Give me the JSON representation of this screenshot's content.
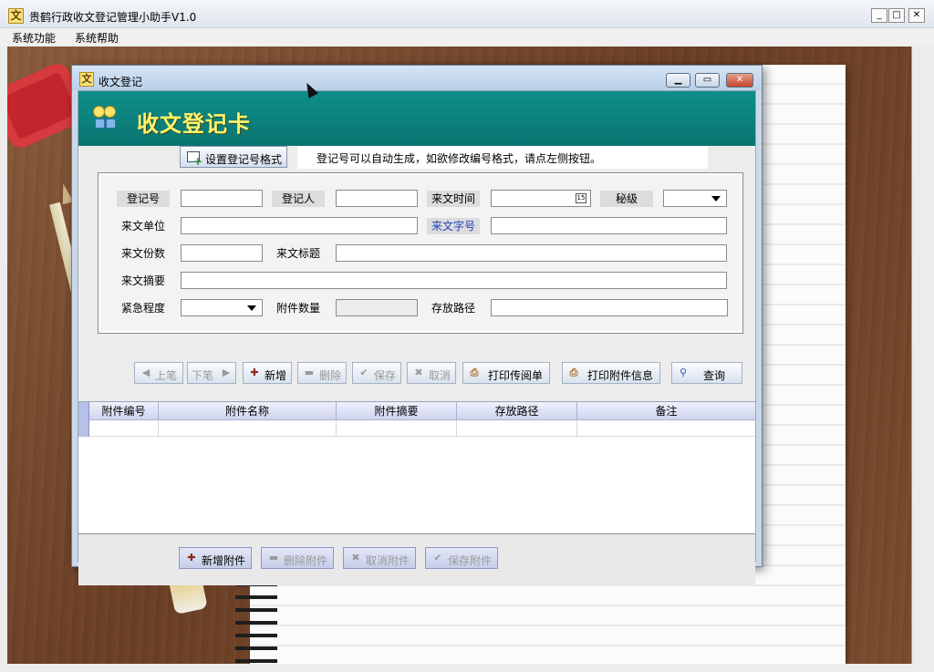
{
  "app": {
    "title": "贵鹤行政收文登记管理小助手V1.0",
    "icon_char": "文",
    "window_buttons": {
      "minimize": "_",
      "maximize": "□",
      "close": "✕"
    }
  },
  "menu": [
    "系统功能",
    "系统帮助"
  ],
  "dialog": {
    "title": "收文登记",
    "icon_char": "文",
    "banner_title": "收文登记卡",
    "format_button": "设置登记号格式",
    "hint": "登记号可以自动生成，如欲修改编号格式，请点左侧按钮。",
    "form": {
      "labels": {
        "reg_no": "登记号",
        "registrar": "登记人",
        "incoming_time": "来文时间",
        "secrecy": "秘级",
        "sender_unit": "来文单位",
        "doc_no": "来文字号",
        "copies": "来文份数",
        "doc_title": "来文标题",
        "summary": "来文摘要",
        "urgency": "紧急程度",
        "attach_count": "附件数量",
        "storage_path": "存放路径"
      },
      "values": {
        "reg_no": "",
        "registrar": "",
        "incoming_time": "",
        "secrecy": "",
        "sender_unit": "",
        "doc_no": "",
        "copies": "",
        "doc_title": "",
        "summary": "",
        "urgency": "",
        "attach_count": "",
        "storage_path": ""
      },
      "calendar_icon_text": "15"
    },
    "toolbar": {
      "prev": "上笔",
      "next": "下笔",
      "add": "新增",
      "delete": "删除",
      "save": "保存",
      "cancel": "取消",
      "print_circulation": "打印传阅单",
      "print_attachment": "打印附件信息",
      "query": "查询"
    },
    "grid": {
      "columns": [
        "附件编号",
        "附件名称",
        "附件摘要",
        "存放路径",
        "备注"
      ],
      "rows": [
        [
          "",
          "",
          "",
          "",
          ""
        ]
      ]
    },
    "attachment_buttons": {
      "add": "新增附件",
      "delete": "删除附件",
      "cancel": "取消附件",
      "save": "保存附件"
    }
  },
  "colors": {
    "banner": "#0a7f7b",
    "banner_text": "#fff36a",
    "label_blue": "#1f3fb5"
  }
}
